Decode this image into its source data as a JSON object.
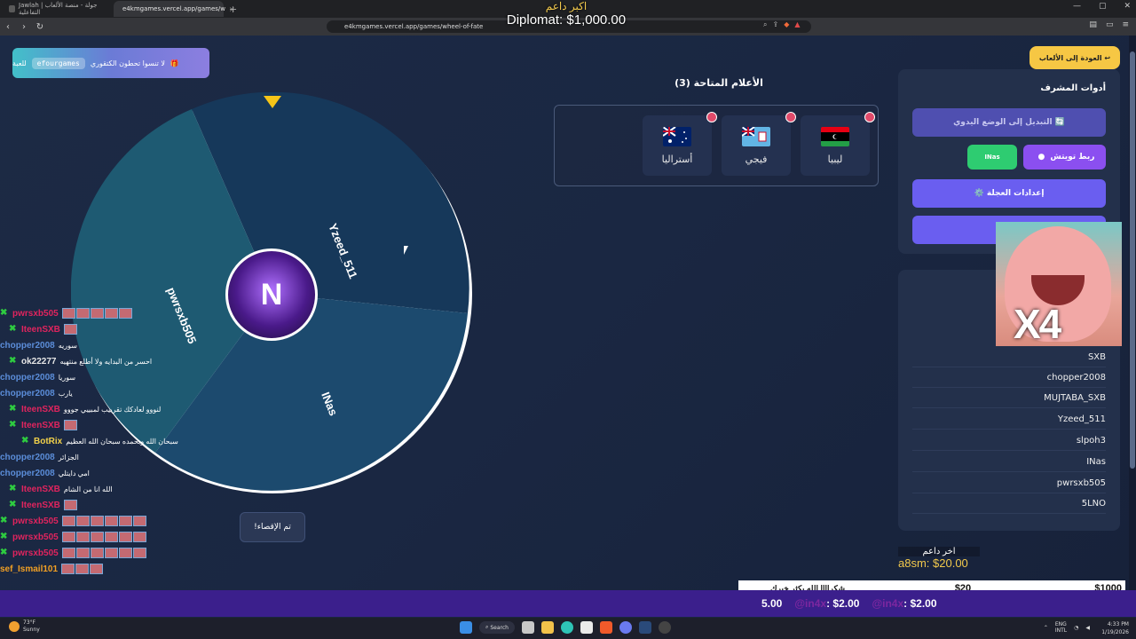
{
  "browser": {
    "tabs": [
      {
        "label": "Jawlah | جولة - منصة الألعاب التفاعلية"
      },
      {
        "label": "e4kmgames.vercel.app/games/w"
      }
    ],
    "url": "e4kmgames.vercel.app/games/wheel-of-fate",
    "new_tab": "+"
  },
  "stream_overlay": {
    "top_label": "اكبر داعم",
    "top_value": "Diplomat: $1,000.00",
    "last_donor_label": "اخر داعم",
    "last_donor_value": "a8sm: $20.00",
    "ticker_msg": "شكراااا الله يكثر خيرك",
    "ticker_amount": "$20",
    "ticker_total": "$1000",
    "ticker2": [
      "5.00",
      "@in4x",
      ": $2.00",
      "@in4x",
      ": $2.00"
    ]
  },
  "promo": {
    "text": "لا تنسوا تحطون الكتقوري",
    "code": "efourgames",
    "suffix": "للعبة"
  },
  "back_button": "العودة إلى الألعاب ↩",
  "flags": {
    "title": "الأعلام المتاحة (3)",
    "items": [
      {
        "name": "ليبيا"
      },
      {
        "name": "فيجي"
      },
      {
        "name": "أستراليا"
      }
    ]
  },
  "admin": {
    "title": "أدوات المشرف",
    "manual_mode": "التبديل إلى الوضع اليدوي 🔄",
    "twitch_connect": "ربط تويتش",
    "twitch_user": "INas",
    "wheel_settings": "⚙️ إعدادات العجلة",
    "fourth_button": "♻️"
  },
  "names_list": [
    "SXB",
    "chopper2008",
    "MUJTABA_SXB",
    "Yzeed_511",
    "slpoh3",
    "INas",
    "pwrsxb505",
    "5LNO"
  ],
  "sticker_text": "X4",
  "wheel": {
    "segments": [
      "Yzeed_511",
      "INas",
      "pwrsxb505"
    ],
    "center_letter": "N",
    "done_button": "!تم الإقصاء"
  },
  "chat": [
    {
      "user": "pwrsxb505",
      "msg": "",
      "color": "#e0245e",
      "emotes": 5,
      "badge": true
    },
    {
      "user": "IteenSXB",
      "msg": "",
      "color": "#e0245e",
      "emotes": 1,
      "badge": true
    },
    {
      "user": "chopper2008",
      "msg": "سوريه",
      "color": "#5b8dd9",
      "emotes": 0,
      "badge": false
    },
    {
      "user": "ok22277",
      "msg": "احسر من البدايه ولا أطلع منتهيه",
      "color": "#e6e6e6",
      "emotes": 0,
      "badge": true
    },
    {
      "user": "chopper2008",
      "msg": "سوريا",
      "color": "#5b8dd9",
      "emotes": 0,
      "badge": false
    },
    {
      "user": "chopper2008",
      "msg": "يارب",
      "color": "#5b8dd9",
      "emotes": 0,
      "badge": false
    },
    {
      "user": "IteenSXB",
      "msg": "لنووو لعادكك تقرييب لمبييي جووو",
      "color": "#e0245e",
      "emotes": 0,
      "badge": true
    },
    {
      "user": "IteenSXB",
      "msg": "",
      "color": "#e0245e",
      "emotes": 1,
      "badge": true
    },
    {
      "user": "BotRix",
      "msg": "سبحان الله وبحمده سبحان الله العظيم",
      "color": "#f2d14a",
      "emotes": 0,
      "badge": true
    },
    {
      "user": "chopper2008",
      "msg": "الجزائر",
      "color": "#5b8dd9",
      "emotes": 0,
      "badge": false
    },
    {
      "user": "chopper2008",
      "msg": "امي دايتلي",
      "color": "#5b8dd9",
      "emotes": 0,
      "badge": false
    },
    {
      "user": "IteenSXB",
      "msg": "الله انا من الشام",
      "color": "#e0245e",
      "emotes": 0,
      "badge": true
    },
    {
      "user": "IteenSXB",
      "msg": "",
      "color": "#e0245e",
      "emotes": 1,
      "badge": true
    },
    {
      "user": "pwrsxb505",
      "msg": "",
      "color": "#e0245e",
      "emotes": 6,
      "badge": true
    },
    {
      "user": "pwrsxb505",
      "msg": "",
      "color": "#e0245e",
      "emotes": 6,
      "badge": true
    },
    {
      "user": "pwrsxb505",
      "msg": "",
      "color": "#e0245e",
      "emotes": 6,
      "badge": true
    },
    {
      "user": "sef_Ismail101",
      "msg": "",
      "color": "#f2a024",
      "emotes": 3,
      "badge": false
    }
  ],
  "taskbar": {
    "weather_temp": "73°F",
    "weather_desc": "Sunny",
    "search": "Search",
    "lang1": "ENG",
    "lang2": "INTL",
    "time": "4:33 PM",
    "date": "1/19/2026"
  },
  "colors": {
    "accent": "#6a5ef0",
    "wheel_border": "#ffffff",
    "pointer": "#f5c518",
    "ticker_bg": "#3b1f8c"
  }
}
